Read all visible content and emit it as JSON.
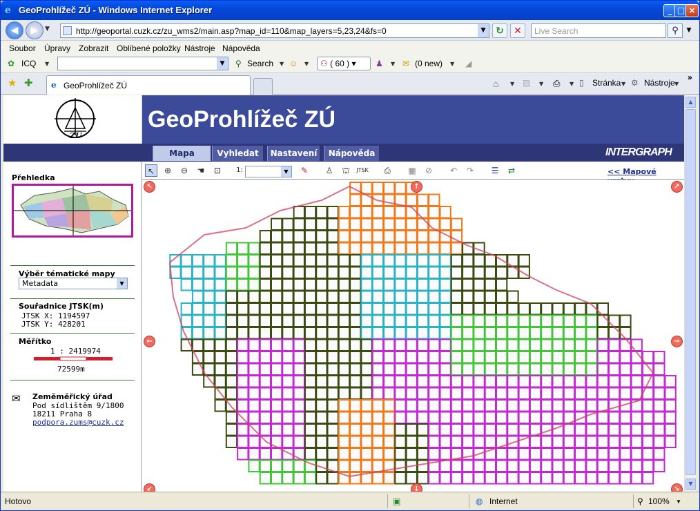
{
  "window": {
    "title": "GeoProhlížeč ZÚ - Windows Internet Explorer"
  },
  "address": {
    "url": "http://geoportal.cuzk.cz/zu_wms2/main.asp?map_id=110&map_layers=5,23,24&fs=0",
    "search_placeholder": "Live Search"
  },
  "menu": [
    "Soubor",
    "Úpravy",
    "Zobrazit",
    "Oblíbené položky",
    "Nástroje",
    "Nápověda"
  ],
  "icq": {
    "label": "ICQ",
    "search_label": "Search",
    "count": "( 60 )",
    "mail": "(0 new)"
  },
  "tabs": {
    "active": "GeoProhlížeč ZÚ",
    "page_cmd": "Stránka",
    "tools_cmd": "Nástroje"
  },
  "app": {
    "title": "GeoProhlížeč ZÚ",
    "logo_text": "ZÚ",
    "brand": "INTERGRAPH",
    "nav": [
      "Mapa",
      "Vyhledat",
      "Nastavení",
      "Nápověda"
    ],
    "map_layers_link": "<< Mapové vrstvy",
    "scale_prefix": "1:"
  },
  "left": {
    "overview_title": "Přehledka",
    "theme_title": "Výběr tématické mapy",
    "theme_value": "Metadata",
    "coords_title": "Souřadnice JTSK(m)",
    "jtsk_x": "JTSK X: 1194597",
    "jtsk_y": "JTSK Y: 428201",
    "scale_title": "Měřítko",
    "scale_value": "1 : 2419974",
    "scale_bar_label": "72599m",
    "office_name": "Zeměměřický úřad",
    "office_street": "Pod sídlištěm 9/1800",
    "office_city": "18211 Praha 8",
    "office_email": "podpora.zums@cuzk.cz"
  },
  "status": {
    "left": "Hotovo",
    "zone": "Internet",
    "zoom": "100%"
  },
  "colors": {
    "banner": "#3c4b99",
    "navstrip": "#2e3678",
    "grid_orange": "#f07a1a",
    "grid_cyan": "#2bb3c3",
    "grid_green": "#45c33b",
    "grid_dark": "#3a4a12",
    "grid_magenta": "#c12ad0",
    "border_red": "#d04060"
  }
}
